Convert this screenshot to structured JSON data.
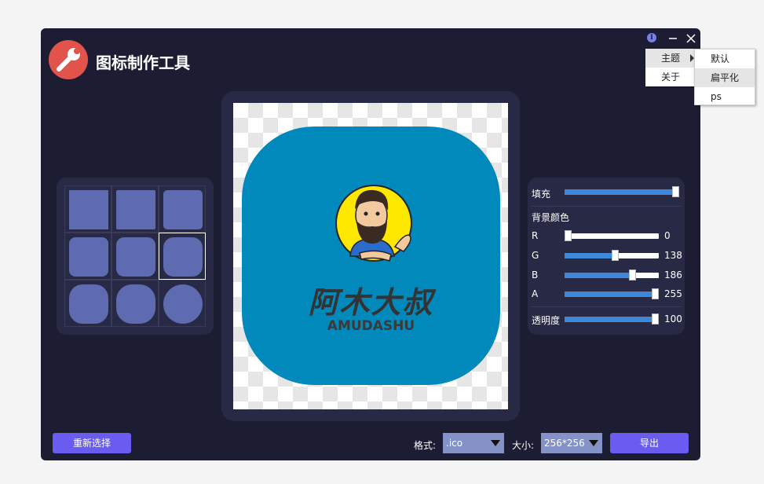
{
  "app": {
    "title": "图标制作工具"
  },
  "titlebar": {
    "info_glyph": "i",
    "minimize_glyph": "−",
    "close_glyph": "✕"
  },
  "shapes": {
    "cells": [
      {
        "shape": "square"
      },
      {
        "shape": "square"
      },
      {
        "shape": "square"
      },
      {
        "shape": "rounded-small"
      },
      {
        "shape": "rounded-small"
      },
      {
        "shape": "rounded-medium"
      },
      {
        "shape": "rounded-large"
      },
      {
        "shape": "rounded-large"
      },
      {
        "shape": "circle"
      }
    ],
    "selected_index": 5
  },
  "preview": {
    "icon_bg_color": "#0189bb",
    "brand_cn": "阿木大叔",
    "brand_en": "AMUDASHU"
  },
  "controls": {
    "fill": {
      "label": "填充",
      "value": 1.0
    },
    "bg_color_label": "背景颜色",
    "r": {
      "label": "R",
      "value": "0",
      "level": 0
    },
    "g": {
      "label": "G",
      "value": "138",
      "level": 138
    },
    "b": {
      "label": "B",
      "value": "186",
      "level": 186
    },
    "a": {
      "label": "A",
      "value": "255",
      "level": 255
    },
    "opacity": {
      "label": "透明度",
      "value": "100",
      "level": 100
    }
  },
  "footer": {
    "reselect_label": "重新选择",
    "format_label": "格式:",
    "format_value": ".ico",
    "size_label": "大小:",
    "size_value": "256*256",
    "export_label": "导出"
  },
  "menu": {
    "items": [
      {
        "label": "主题"
      },
      {
        "label": "关于"
      }
    ],
    "theme_submenu": [
      {
        "label": "默认"
      },
      {
        "label": "扁平化"
      },
      {
        "label": "ps"
      }
    ]
  },
  "colors": {
    "window_bg": "#1c1d33",
    "panel_bg": "#282944",
    "accent": "#6a5cf0",
    "slider_fill": "#3d88d8"
  }
}
